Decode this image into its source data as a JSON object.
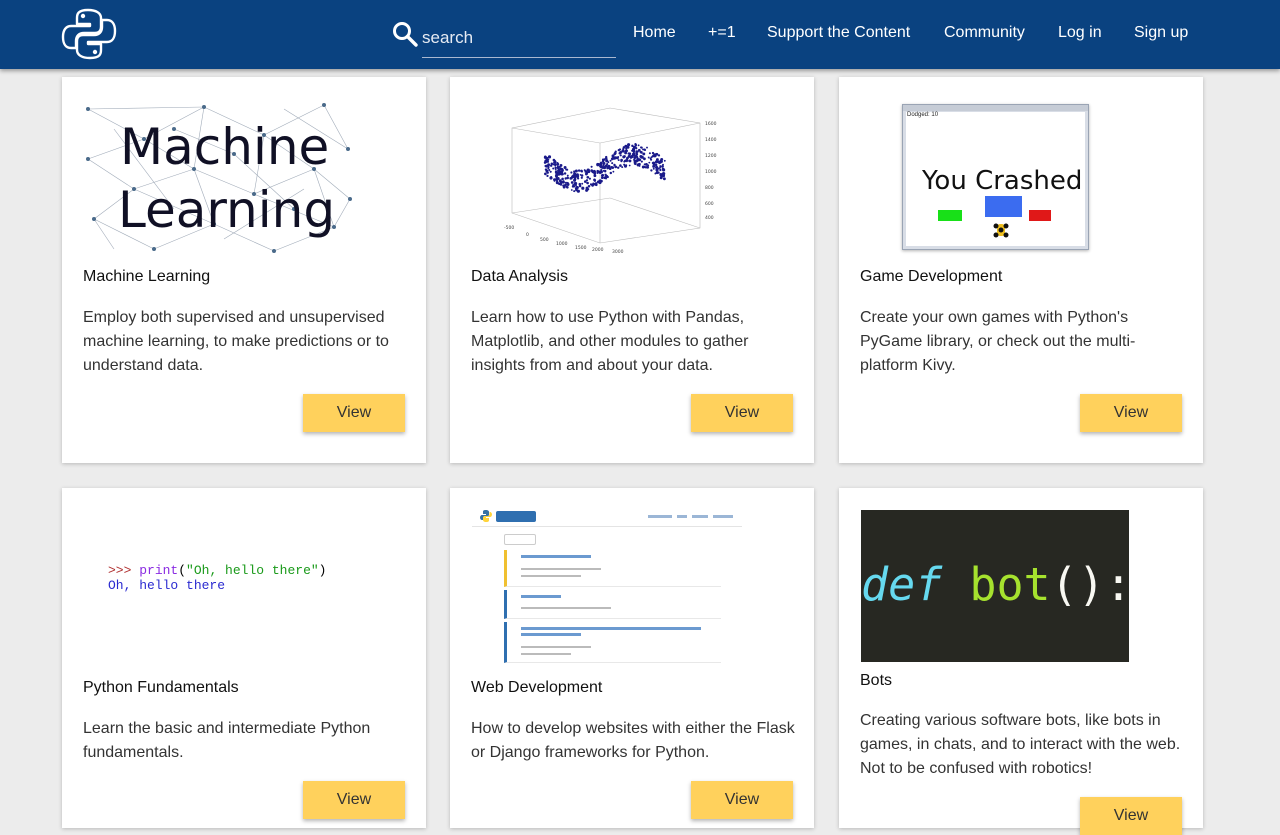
{
  "header": {
    "search_placeholder": "search",
    "nav": [
      "Home",
      "+=1",
      "Support the Content",
      "Community",
      "Log in",
      "Sign up"
    ]
  },
  "colors": {
    "header_bg": "#0a4280",
    "button_bg": "#ffd15c",
    "page_bg": "#ececec"
  },
  "cards": [
    {
      "title": "Machine Learning",
      "description": "Employ both supervised and unsupervised machine learning, to make predictions or to understand data.",
      "button": "View",
      "image": {
        "line1": "Machine",
        "line2": "Learning"
      }
    },
    {
      "title": "Data Analysis",
      "description": "Learn how to use Python with Pandas, Matplotlib, and other modules to gather insights from and about your data.",
      "button": "View"
    },
    {
      "title": "Game Development",
      "description": "Create your own games with Python's PyGame library, or check out the multi-platform Kivy.",
      "button": "View",
      "image": {
        "score": "Dodged: 10",
        "message": "You Crashed"
      }
    },
    {
      "title": "Python Fundamentals",
      "description": "Learn the basic and intermediate Python fundamentals.",
      "button": "View",
      "image": {
        "prompt": ">>> ",
        "fn": "print",
        "open": "(",
        "str": "\"Oh, hello there\"",
        "close": ")",
        "output": "Oh, hello there"
      }
    },
    {
      "title": "Web Development",
      "description": "How to develop websites with either the Flask or Django frameworks for Python.",
      "button": "View"
    },
    {
      "title": "Bots",
      "description": "Creating various software bots, like bots in games, in chats, and to interact with the web. Not to be confused with robotics!",
      "button": "View",
      "image": {
        "kw": "def",
        "name": "bot",
        "parens": "():"
      }
    }
  ]
}
